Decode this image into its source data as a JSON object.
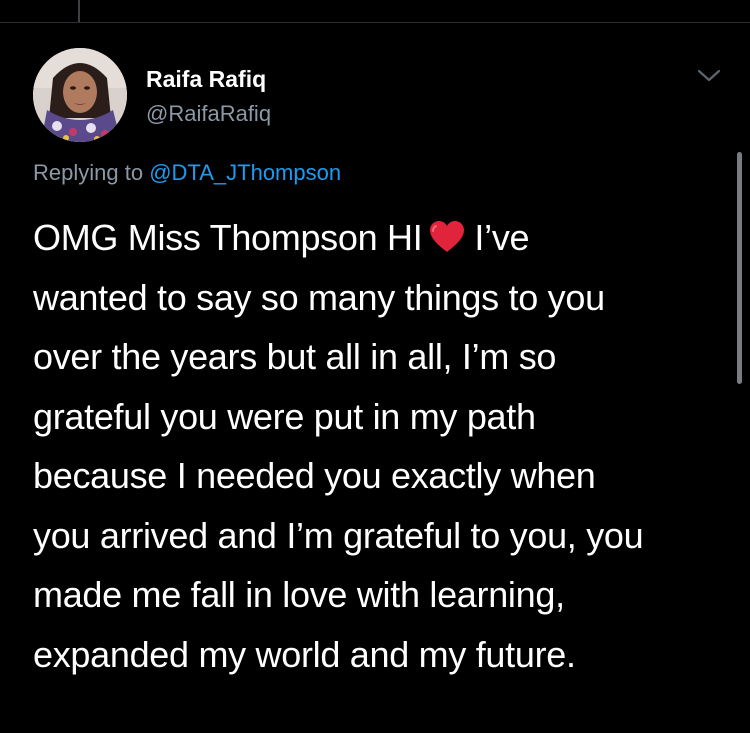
{
  "tweet": {
    "author": {
      "display_name": "Raifa Rafiq",
      "handle": "@RaifaRafiq"
    },
    "reply": {
      "prefix": "Replying to",
      "mention": "@DTA_JThompson"
    },
    "text": {
      "line1_before": "OMG Miss Thompson HI",
      "line1_after": "I’ve",
      "line2": "wanted to say so many things to you",
      "line3": "over the years but all in all, I’m so",
      "line4": "grateful you were put in my path",
      "line5": "because I needed you exactly when",
      "line6": "you arrived and I’m grateful to you, you",
      "line7": "made me fall in love with learning,",
      "line8": "expanded my world and my future."
    },
    "icons": {
      "heart": "red-heart-emoji",
      "menu": "chevron-down-icon"
    }
  },
  "colors": {
    "background": "#000000",
    "text": "#ffffff",
    "secondary_text": "#8b98a5",
    "link": "#1d9bf0",
    "heart": "#e0243b"
  }
}
